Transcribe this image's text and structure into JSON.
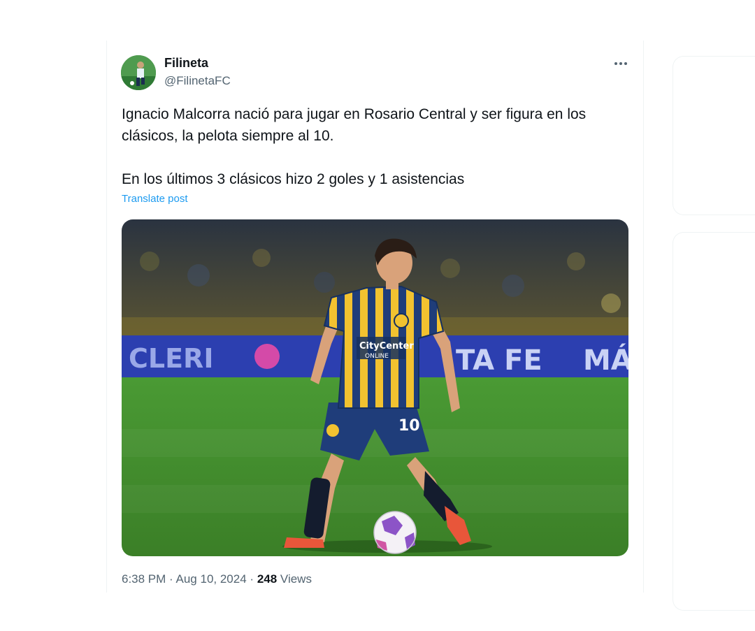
{
  "author": {
    "display_name": "Filineta",
    "handle": "@FilinetaFC"
  },
  "post": {
    "text_line1": "Ignacio Malcorra nació para jugar en Rosario Central y ser figura en los clásicos, la pelota siempre al 10.",
    "text_line2": "En los últimos 3 clásicos hizo 2 goles y 1 asistencias",
    "translate_label": "Translate post"
  },
  "media": {
    "ad_board_left": "CLERI",
    "ad_board_right": "TA FE",
    "ad_board_far_right": "MÁ",
    "jersey_sponsor": "CityCenter",
    "jersey_sponsor_sub": "ONLINE",
    "shorts_number": "10"
  },
  "meta": {
    "time": "6:38 PM",
    "separator": "·",
    "date": "Aug 10, 2024",
    "views_count": "248",
    "views_label": "Views"
  },
  "colors": {
    "link": "#1d9bf0",
    "secondary_text": "#536471",
    "jersey_blue": "#1f3d7a",
    "jersey_yellow": "#f2c230",
    "pitch": "#3e8a2c"
  }
}
